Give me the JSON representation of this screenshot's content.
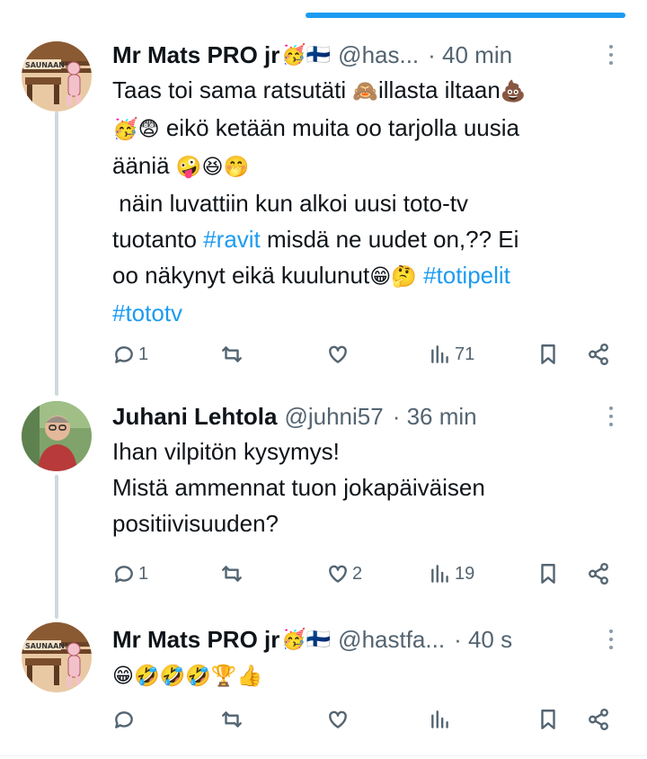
{
  "progress": 0.5,
  "tweets": [
    {
      "name": "Mr Mats PRO jr",
      "name_emojis": "🥳🇫🇮",
      "handle": "@has...",
      "time": "· 40 min",
      "text_parts": [
        "Taas toi sama ratsutäti ",
        "🙈",
        "illasta iltaan",
        "💩",
        "\n",
        "🥳😨",
        " eikö ketään muita oo tarjolla uusia\nääniä ",
        "🤪😆🤭",
        "\n näin luvattiin kun alkoi uusi toto-tv\ntuotanto ",
        "#ravit",
        " misdä ne uudet on,?? Ei\noo näkynyt eikä kuulunut",
        "😁🤔",
        " ",
        "#totipelit",
        "\n",
        "#tototv"
      ],
      "stats": {
        "replies": "1",
        "retweets": "",
        "likes": "",
        "views": "71"
      }
    },
    {
      "name": "Juhani Lehtola",
      "handle": "@juhni57",
      "time": "· 36 min",
      "text": "Ihan vilpitön kysymys!\nMistä ammennat tuon jokapäiväisen\npositiivisuuden?",
      "stats": {
        "replies": "1",
        "retweets": "",
        "likes": "2",
        "views": "19"
      }
    },
    {
      "name": "Mr Mats PRO jr",
      "name_emojis": "🥳🇫🇮",
      "handle": "@hastfa...",
      "time": "· 40 s",
      "text": "😁🤣🤣🤣🏆👍",
      "stats": {
        "replies": "",
        "retweets": "",
        "likes": "",
        "views": ""
      }
    }
  ],
  "colors": {
    "accent": "#1d9bf0",
    "text": "#0f1419",
    "secondary": "#536471",
    "thread_line": "#cfd9de"
  },
  "icons": [
    "reply-icon",
    "retweet-icon",
    "like-icon",
    "views-icon",
    "bookmark-icon",
    "share-icon",
    "more-icon"
  ]
}
